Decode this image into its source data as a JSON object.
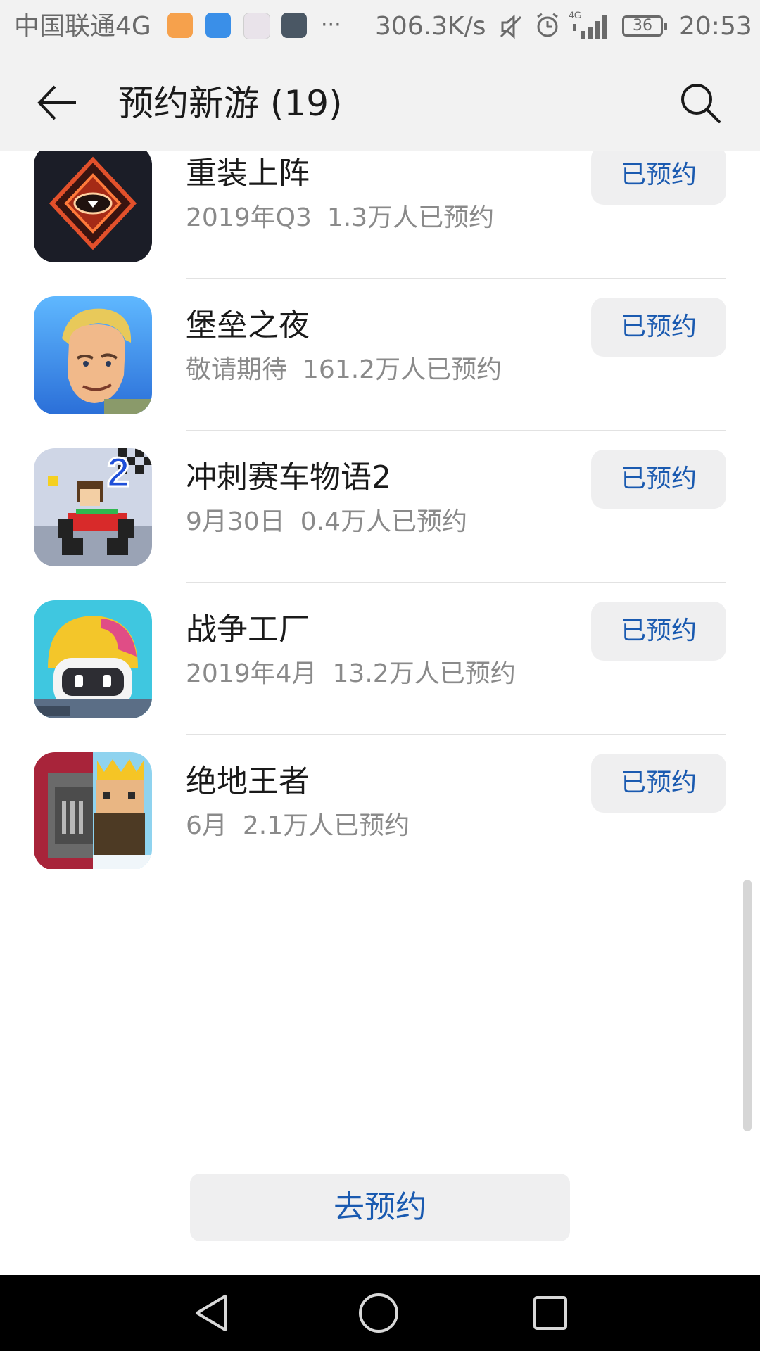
{
  "status_bar": {
    "carrier": "中国联通4G",
    "more": "···",
    "net_speed": "306.3K/s",
    "network_type": "4G",
    "battery": "36",
    "time": "20:53",
    "icons": [
      "health-app-icon",
      "messages-app-icon",
      "gallery-app-icon",
      "browser-app-icon",
      "mute-icon",
      "alarm-icon",
      "signal-icon",
      "battery-icon"
    ]
  },
  "header": {
    "title": "预约新游 (19)",
    "back_icon": "back-arrow-icon",
    "search_icon": "search-icon"
  },
  "games": [
    {
      "name": "重装上阵",
      "date": "2019年Q3",
      "reservations": "1.3万人已预约",
      "button": "已预约",
      "icon": "game-icon-zhongzhuang"
    },
    {
      "name": "堡垒之夜",
      "date": "敬请期待",
      "reservations": "161.2万人已预约",
      "button": "已预约",
      "icon": "game-icon-fortnite"
    },
    {
      "name": "冲刺赛车物语2",
      "date": "9月30日",
      "reservations": "0.4万人已预约",
      "button": "已预约",
      "icon": "game-icon-racing"
    },
    {
      "name": "战争工厂",
      "date": "2019年4月",
      "reservations": "13.2万人已预约",
      "button": "已预约",
      "icon": "game-icon-war-factory"
    },
    {
      "name": "绝地王者",
      "date": "6月",
      "reservations": "2.1万人已预约",
      "button": "已预约",
      "icon": "game-icon-jedi-king"
    }
  ],
  "footer": {
    "go_reserve": "去预约"
  },
  "colors": {
    "accent": "#1a5ab0",
    "button_bg": "#efeff0",
    "header_bg": "#f2f2f2"
  }
}
